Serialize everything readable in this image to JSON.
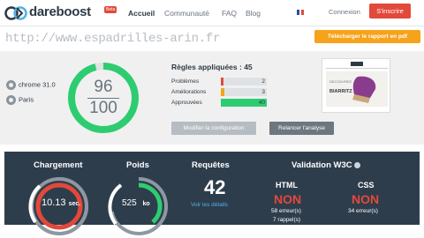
{
  "header": {
    "logo_text": "dareboost",
    "beta_label": "Beta",
    "nav": [
      "Accueil",
      "Communauté",
      "FAQ",
      "Blog"
    ],
    "connexion": "Connexion",
    "inscrire": "S'inscrire",
    "colors": {
      "accent_red": "#e2493b",
      "dark": "#2d3a45"
    }
  },
  "url_bar": {
    "url": "http://www.espadrilles-arin.fr",
    "download_label": "Télécharger le rapport en pdf"
  },
  "summary": {
    "browser": "chrome 31.0",
    "location": "Paris",
    "score": {
      "value": "96",
      "max": "100",
      "fraction": 0.96
    },
    "rules_title": "Règles appliquées : 45",
    "rules": [
      {
        "label": "Problèmes",
        "count": "2",
        "color": "#e2493b",
        "fraction": 0.05
      },
      {
        "label": "Améliorations",
        "count": "3",
        "color": "#f7a21b",
        "fraction": 0.07
      },
      {
        "label": "Approuvées",
        "count": "40",
        "color": "#2ecc71",
        "fraction": 1.0
      }
    ],
    "config_button": "Modifier la configuration",
    "relaunch_button": "Relancer l'analyse",
    "thumbnail_text": "BIARRITZ"
  },
  "metrics": {
    "loading": {
      "title": "Chargement",
      "value": "10.13",
      "unit": "sec."
    },
    "weight": {
      "title": "Poids",
      "value": "525",
      "unit": "ko"
    },
    "requests": {
      "title": "Requêtes",
      "value": "42",
      "link": "Voir les détails"
    },
    "w3c": {
      "title": "Validation W3C",
      "html": {
        "label": "HTML",
        "status": "NON",
        "errors": "58 erreur(s)",
        "warnings": "7 rappel(s)"
      },
      "css": {
        "label": "CSS",
        "status": "NON",
        "errors": "34 erreur(s)"
      }
    }
  }
}
